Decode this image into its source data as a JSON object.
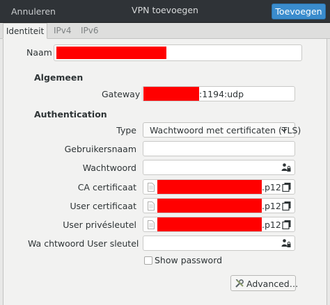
{
  "header": {
    "cancel_label": "Annuleren",
    "title": "VPN toevoegen",
    "add_label": "Toevoegen"
  },
  "tabs": [
    {
      "label": "Identiteit"
    },
    {
      "label": "IPv4"
    },
    {
      "label": "IPv6"
    }
  ],
  "form": {
    "name_label": "Naam",
    "general_heading": "Algemeen",
    "gateway_label": "Gateway",
    "gateway_suffix": ":1194:udp",
    "auth_heading": "Authentication",
    "type_label": "Type",
    "type_value": "Wachtwoord met certificaten (TLS)",
    "username_label": "Gebruikersnaam",
    "password_label": "Wachtwoord",
    "ca_label": "CA certificaat",
    "ca_suffix": ".p12",
    "user_cert_label": "User certificaat",
    "user_cert_suffix": ".p12",
    "user_key_label": "User privésleutel",
    "user_key_suffix": ".p12",
    "key_password_label": "Wa chtwoord User sleutel",
    "show_password_label": "Show password",
    "advanced_label": "Advanced…"
  },
  "colors": {
    "headerbar": "#2f3337",
    "suggested_action": "#3a8ccd",
    "redaction": "#ff0000"
  }
}
